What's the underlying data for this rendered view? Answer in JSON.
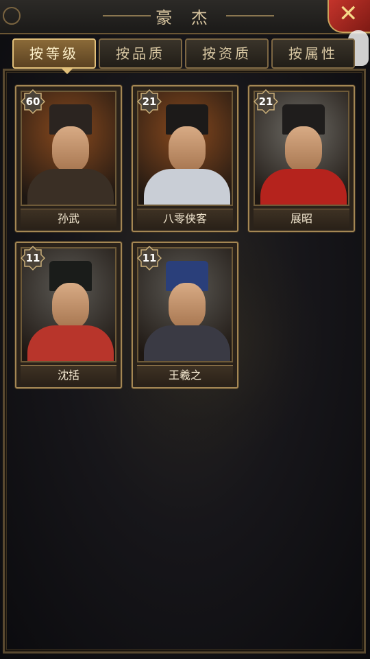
{
  "header": {
    "title": "豪 杰",
    "close_icon": "close-icon"
  },
  "tabs": [
    {
      "label": "按等级",
      "active": true
    },
    {
      "label": "按品质",
      "active": false
    },
    {
      "label": "按资质",
      "active": false
    },
    {
      "label": "按属性",
      "active": false
    }
  ],
  "heroes": [
    {
      "name": "孙武",
      "level": "60",
      "bg": "#8a4a1e",
      "hat": "#2b2420",
      "robe": "#3a2f25"
    },
    {
      "name": "八零侠客",
      "level": "21",
      "bg": "#8a4a1e",
      "hat": "#1c1a19",
      "robe": "#c9ced6"
    },
    {
      "name": "展昭",
      "level": "21",
      "bg": "#6e6c66",
      "hat": "#1f1d1c",
      "robe": "#b5231d"
    },
    {
      "name": "沈括",
      "level": "11",
      "bg": "#5c5a55",
      "hat": "#1a1c1a",
      "robe": "#b8352b"
    },
    {
      "name": "王羲之",
      "level": "11",
      "bg": "#5c5a55",
      "hat": "#2a3f7a",
      "robe": "#3a3a44"
    }
  ]
}
